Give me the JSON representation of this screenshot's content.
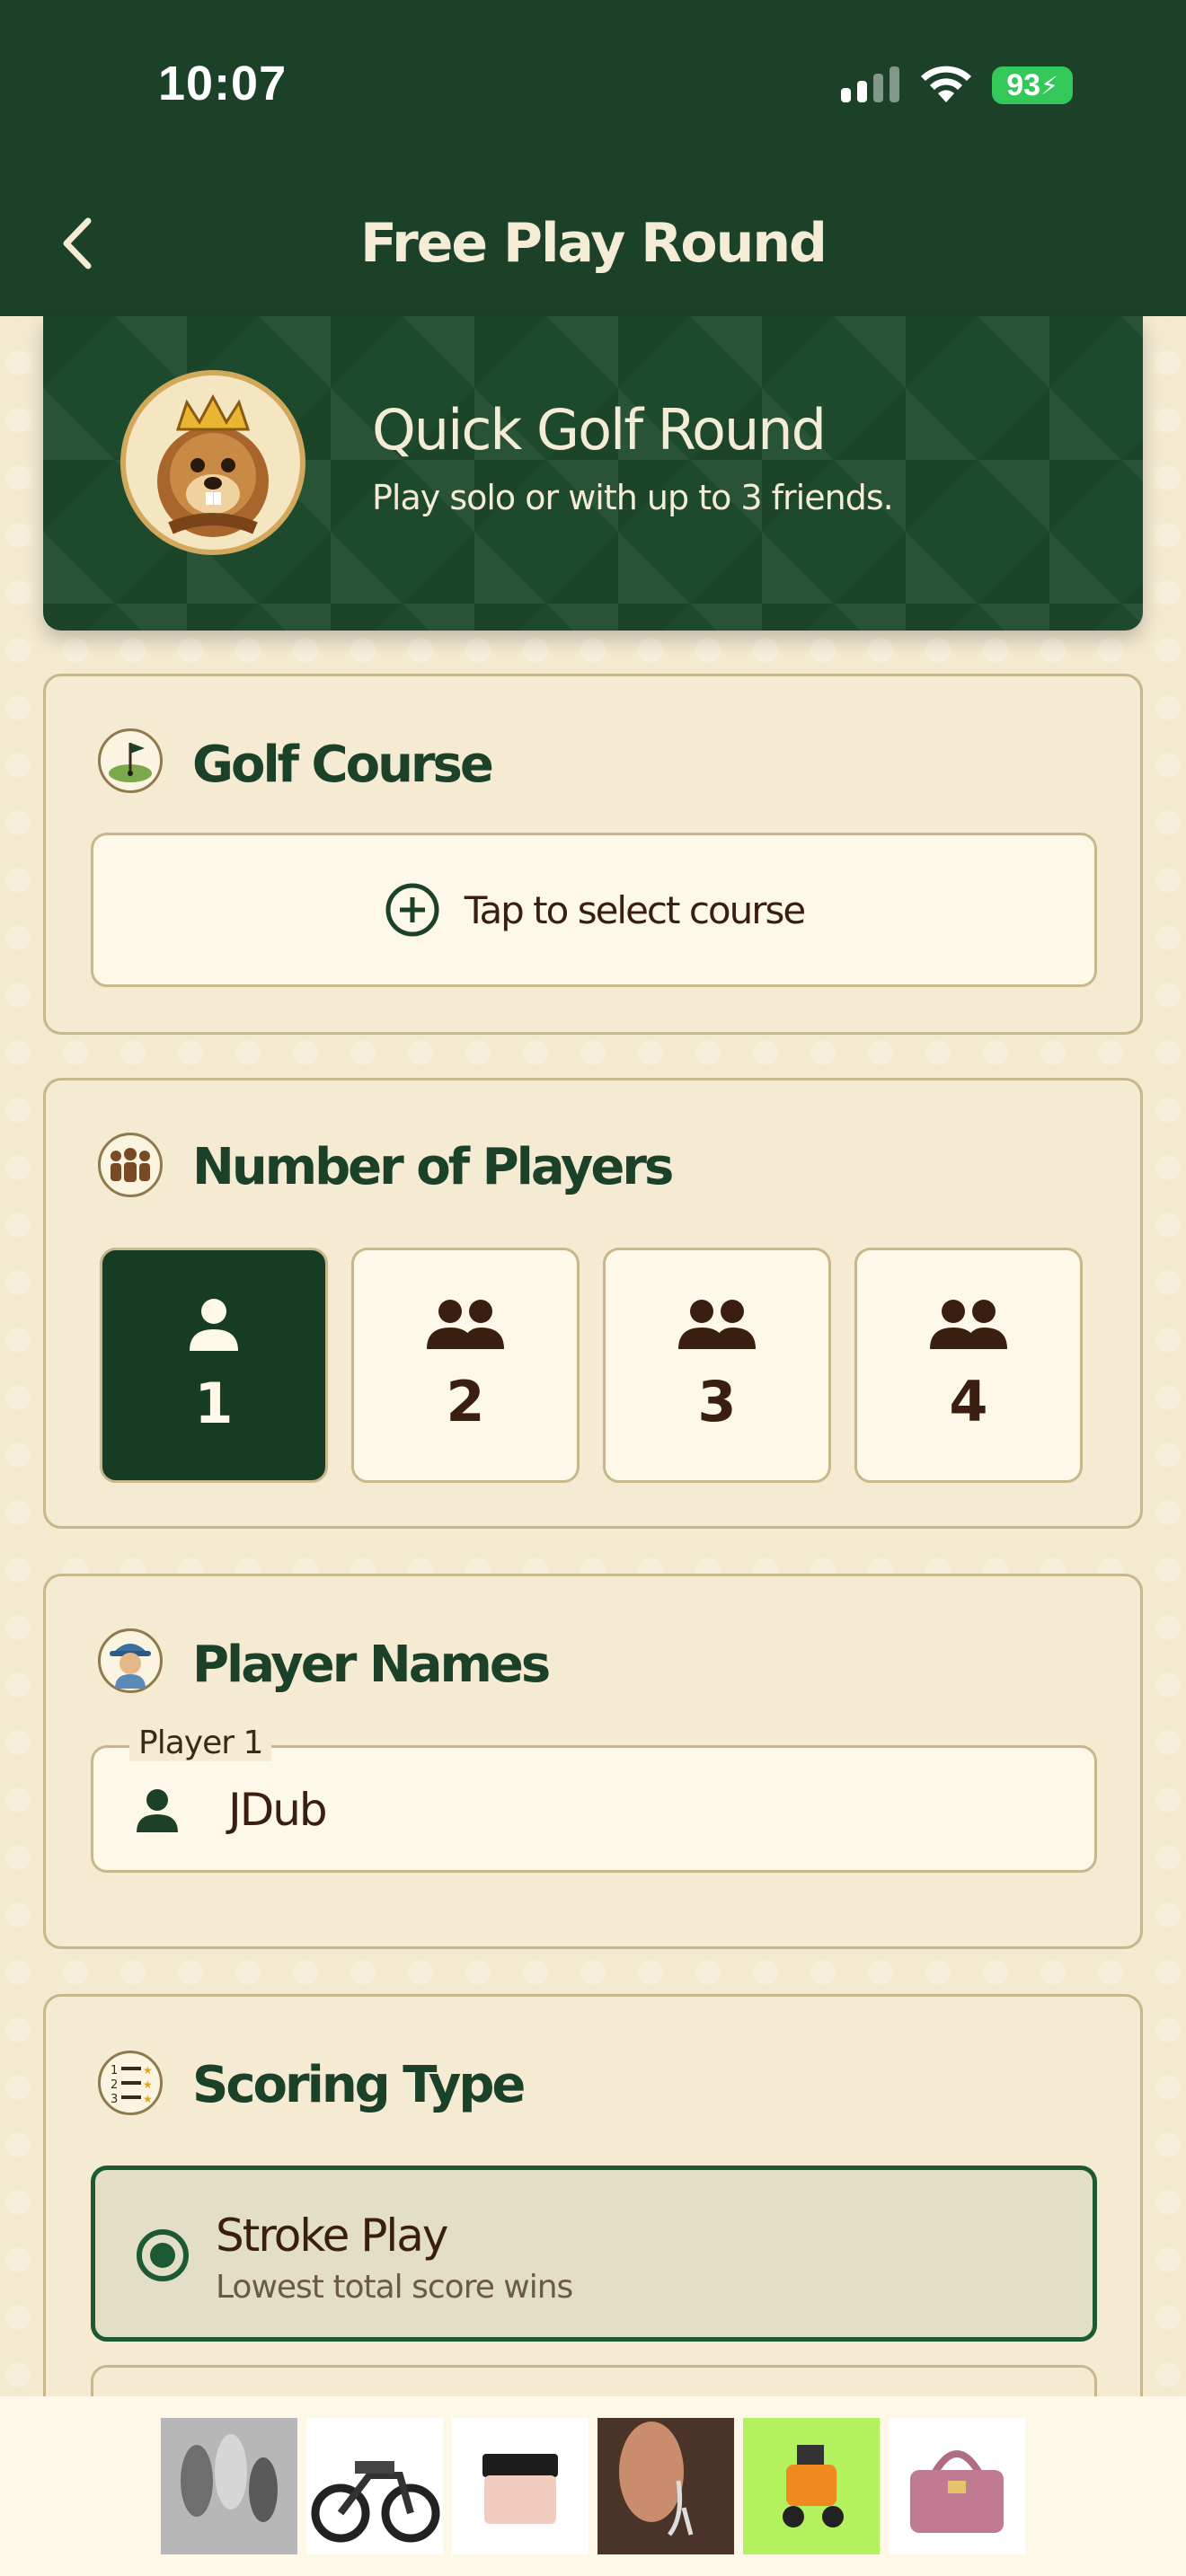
{
  "status_bar": {
    "time": "10:07",
    "battery": "93"
  },
  "nav": {
    "title": "Free Play Round"
  },
  "hero": {
    "title": "Quick Golf Round",
    "subtitle": "Play solo or with up to 3 friends."
  },
  "golf_course": {
    "title": "Golf Course",
    "select_label": "Tap to select course"
  },
  "players": {
    "title": "Number of Players",
    "options": [
      {
        "label": "1",
        "selected": true
      },
      {
        "label": "2",
        "selected": false
      },
      {
        "label": "3",
        "selected": false
      },
      {
        "label": "4",
        "selected": false
      }
    ]
  },
  "player_names": {
    "title": "Player Names",
    "fields": [
      {
        "legend": "Player 1",
        "value": "JDub"
      }
    ]
  },
  "scoring": {
    "title": "Scoring Type",
    "options": [
      {
        "title": "Stroke Play",
        "desc": "Lowest total score wins",
        "selected": true
      }
    ]
  },
  "ads": [
    {
      "name": "nail-polish-ad"
    },
    {
      "name": "ebike-ad"
    },
    {
      "name": "cream-jar-ad"
    },
    {
      "name": "earring-ad"
    },
    {
      "name": "scooter-keychain-ad"
    },
    {
      "name": "handbag-ad"
    }
  ],
  "colors": {
    "primary_green": "#1b4229",
    "card_bg": "#f4ebd2",
    "accent_brown": "#3a1f10"
  }
}
